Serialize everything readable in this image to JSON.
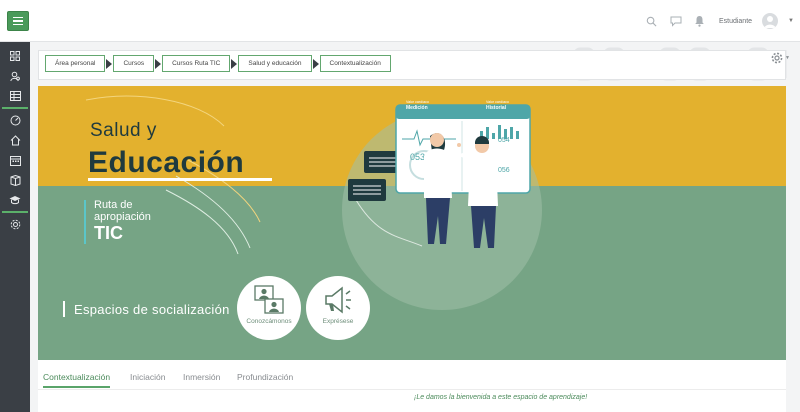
{
  "header": {
    "user_name": "Estudiante"
  },
  "sidebar": {
    "items": [
      {
        "icon": "grid-icon"
      },
      {
        "icon": "user-search-icon"
      },
      {
        "icon": "book-icon"
      },
      {
        "icon": "dashboard-icon"
      },
      {
        "icon": "home-icon"
      },
      {
        "icon": "calendar-icon"
      },
      {
        "icon": "files-icon"
      },
      {
        "icon": "graduation-cap-icon"
      },
      {
        "icon": "settings-icon"
      }
    ]
  },
  "breadcrumb": [
    "Área personal",
    "Cursos",
    "Cursos Ruta TIC",
    "Salud y educación",
    "Contextualización"
  ],
  "banner": {
    "title_line1": "Salud y",
    "title_line2": "Educación",
    "ruta_line1": "Ruta de",
    "ruta_line2": "apropiación",
    "ruta_line3": "TIC",
    "section_label": "Espacios de socialización",
    "buttons": [
      {
        "label": "Conozcámonos",
        "icon": "people-icon"
      },
      {
        "label": "Exprésese",
        "icon": "megaphone-icon"
      }
    ],
    "screen": {
      "left_small": "Valor cardíaco",
      "left_title": "Medición",
      "right_small": "Valor cardíaco",
      "right_title": "Historial",
      "readings": [
        "053",
        "054",
        "056",
        "052"
      ]
    }
  },
  "tabs": [
    "Contextualización",
    "Iniciación",
    "Inmersión",
    "Profundización"
  ],
  "active_tab": "Contextualización",
  "welcome_text": "¡Le damos la bienvenida a este espacio de aprendizaje!",
  "colors": {
    "accent": "#5aa46a",
    "banner_yellow": "#e3b12e",
    "banner_green": "#76a485",
    "title_dark": "#1f3a3e",
    "sidebar_bg": "#3a3f45"
  }
}
